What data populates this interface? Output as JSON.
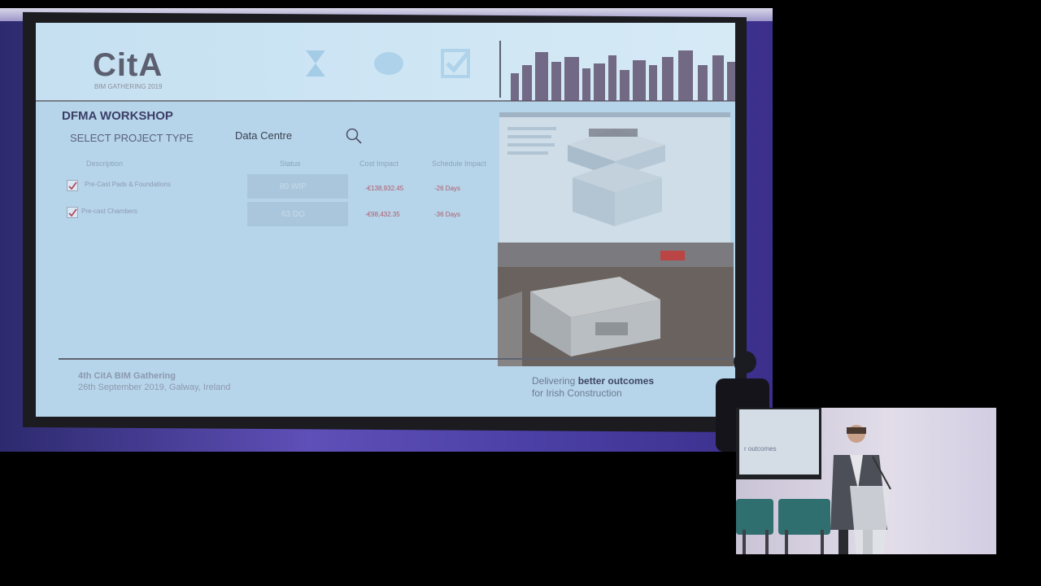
{
  "slide": {
    "logo": "CitA",
    "logo_sub": "BIM GATHERING 2019",
    "title": "DFMA WORKSHOP",
    "select_label": "SELECT PROJECT TYPE",
    "project_value": "Data Centre",
    "columns": [
      "Description",
      "Status",
      "Cost Impact",
      "Schedule Impact"
    ],
    "rows": [
      {
        "description": "Pre-Cast Pads & Foundations",
        "status": "80 WIP",
        "cost": "-€138,932.45",
        "schedule": "-26 Days"
      },
      {
        "description": "Pre-cast Chambers",
        "status": "63 DO",
        "cost": "-€98,432.35",
        "schedule": "-36 Days"
      }
    ],
    "footer_title": "4th CitA BIM Gathering",
    "footer_date": "26th September 2019, Galway, Ireland",
    "tagline_pre": "Delivering ",
    "tagline_bold": "better outcomes",
    "tagline_line2": "for Irish Construction"
  },
  "inset": {
    "screen_text": "r outcomes"
  },
  "colors": {
    "screen_bg": "#b7d5ea",
    "stage_purple": "#5f4fb8",
    "cost_red": "#b05a6a"
  }
}
